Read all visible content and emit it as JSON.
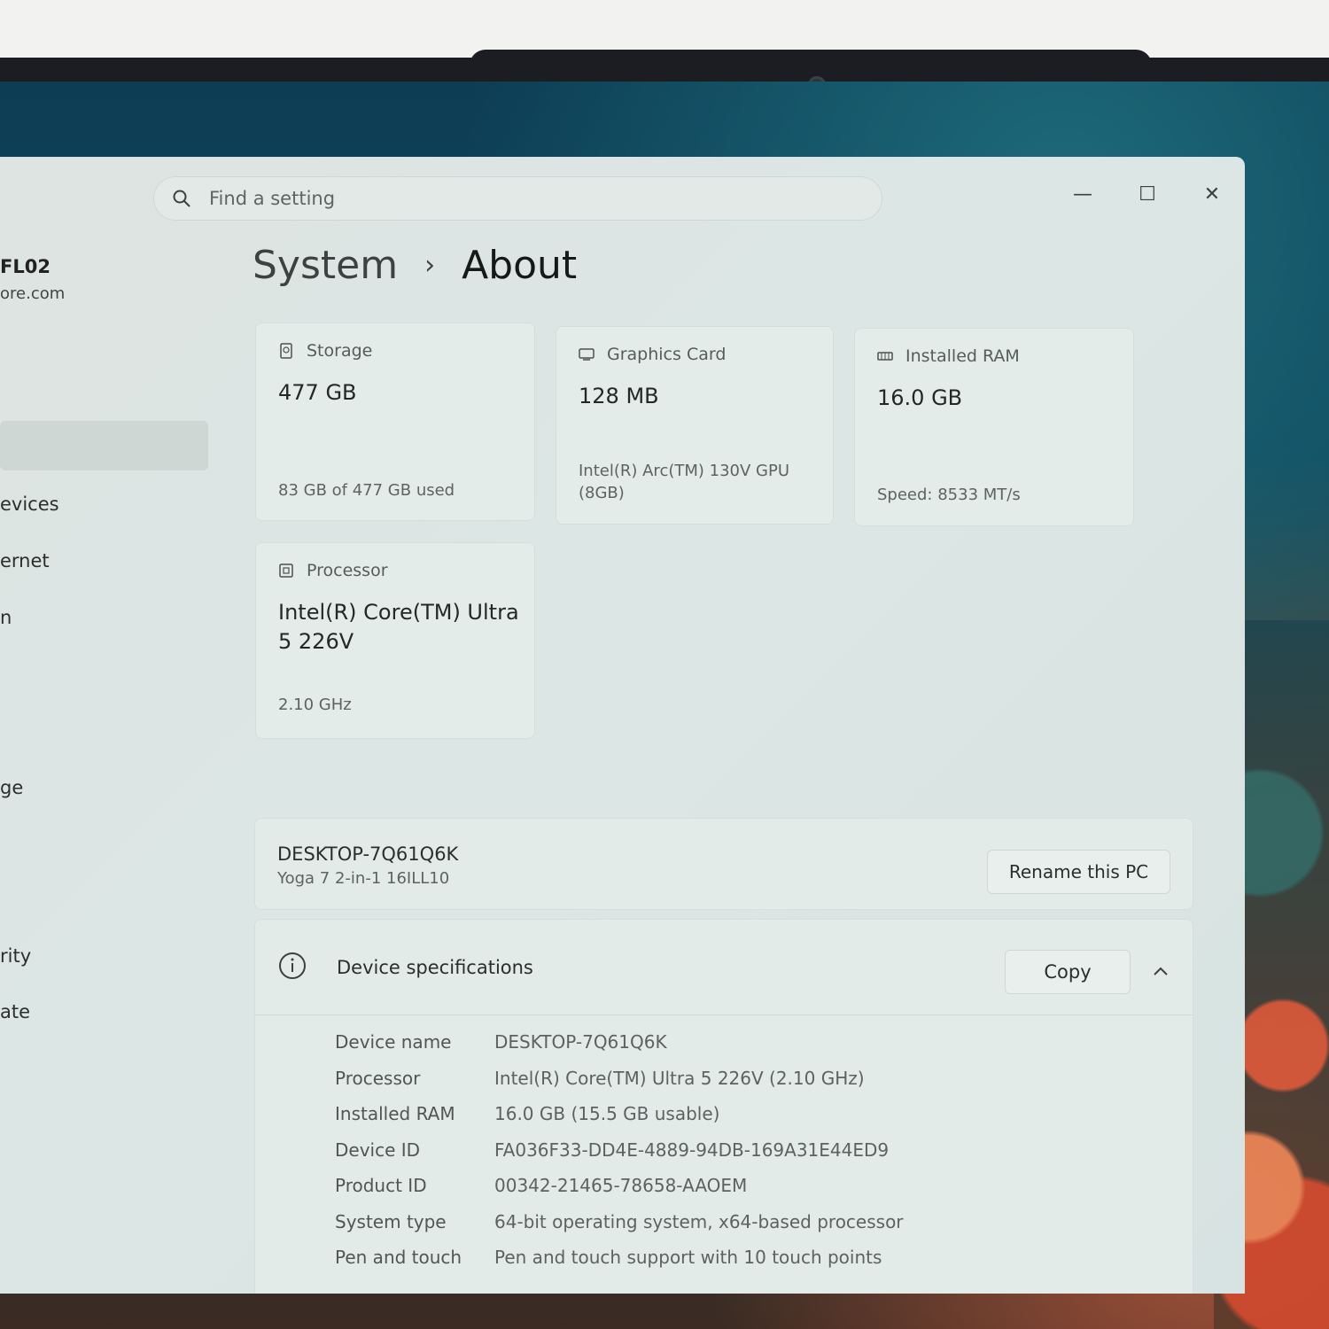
{
  "search": {
    "placeholder": "Find a setting"
  },
  "window_controls": {
    "minimize": "—",
    "maximize": "☐",
    "close": "✕"
  },
  "account": {
    "name": "FL02",
    "email": "ore.com"
  },
  "sidebar": {
    "items": [
      {
        "label": "evices"
      },
      {
        "label": "ernet"
      },
      {
        "label": "n"
      },
      {
        "label": "ge"
      },
      {
        "label": "rity"
      },
      {
        "label": "ate"
      }
    ]
  },
  "breadcrumb": {
    "parent": "System",
    "separator": "›",
    "current": "About"
  },
  "cards": {
    "storage": {
      "label": "Storage",
      "value": "477 GB",
      "sub": "83 GB of 477 GB used",
      "icon": "storage-icon"
    },
    "graphics": {
      "label": "Graphics Card",
      "value": "128 MB",
      "sub_line1": "Intel(R) Arc(TM) 130V GPU",
      "sub_line2": "(8GB)",
      "icon": "graphics-card-icon"
    },
    "ram": {
      "label": "Installed RAM",
      "value": "16.0 GB",
      "sub": "Speed: 8533 MT/s",
      "icon": "ram-icon"
    },
    "processor": {
      "label": "Processor",
      "value_line1": "Intel(R) Core(TM) Ultra",
      "value_line2": "5 226V",
      "sub": "2.10 GHz",
      "icon": "processor-icon"
    }
  },
  "pc": {
    "name": "DESKTOP-7Q61Q6K",
    "model": "Yoga 7 2-in-1 16ILL10",
    "rename_label": "Rename this PC"
  },
  "specs": {
    "title": "Device specifications",
    "copy_label": "Copy",
    "rows": [
      {
        "key": "Device name",
        "value": "DESKTOP-7Q61Q6K"
      },
      {
        "key": "Processor",
        "value": "Intel(R) Core(TM) Ultra 5 226V (2.10 GHz)"
      },
      {
        "key": "Installed RAM",
        "value": "16.0 GB (15.5 GB usable)"
      },
      {
        "key": "Device ID",
        "value": "FA036F33-DD4E-4889-94DB-169A31E44ED9"
      },
      {
        "key": "Product ID",
        "value": "00342-21465-78658-AAOEM"
      },
      {
        "key": "System type",
        "value": "64-bit operating system, x64-based processor"
      },
      {
        "key": "Pen and touch",
        "value": "Pen and touch support with 10 touch points"
      }
    ]
  }
}
